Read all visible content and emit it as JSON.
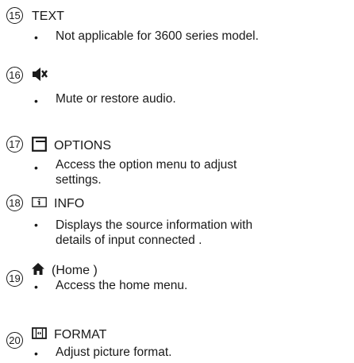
{
  "items": [
    {
      "number": "15",
      "label": "TEXT",
      "icon": "none",
      "bullet": "•",
      "description": "Not applicable for 3600 series  model."
    },
    {
      "number": "16",
      "label": "",
      "icon": "mute-icon",
      "bullet": "•",
      "description": "Mute or restore audio."
    },
    {
      "number": "17",
      "label": "OPTIONS",
      "icon": "options-icon",
      "bullet": "•",
      "description_lines": [
        "Access the option menu to adjust",
        "settings."
      ]
    },
    {
      "number": "18",
      "label": "INFO",
      "icon": "info-icon",
      "bullet": "•",
      "description_lines": [
        "Displays the source information with",
        "details of input connected ."
      ]
    },
    {
      "number": "19",
      "label": "(Home )",
      "icon": "home-icon",
      "bullet": "•",
      "description": "Access the home menu."
    },
    {
      "number": "20",
      "label": "FORMAT",
      "icon": "format-icon",
      "bullet": "•",
      "description": "Adjust picture format."
    }
  ]
}
